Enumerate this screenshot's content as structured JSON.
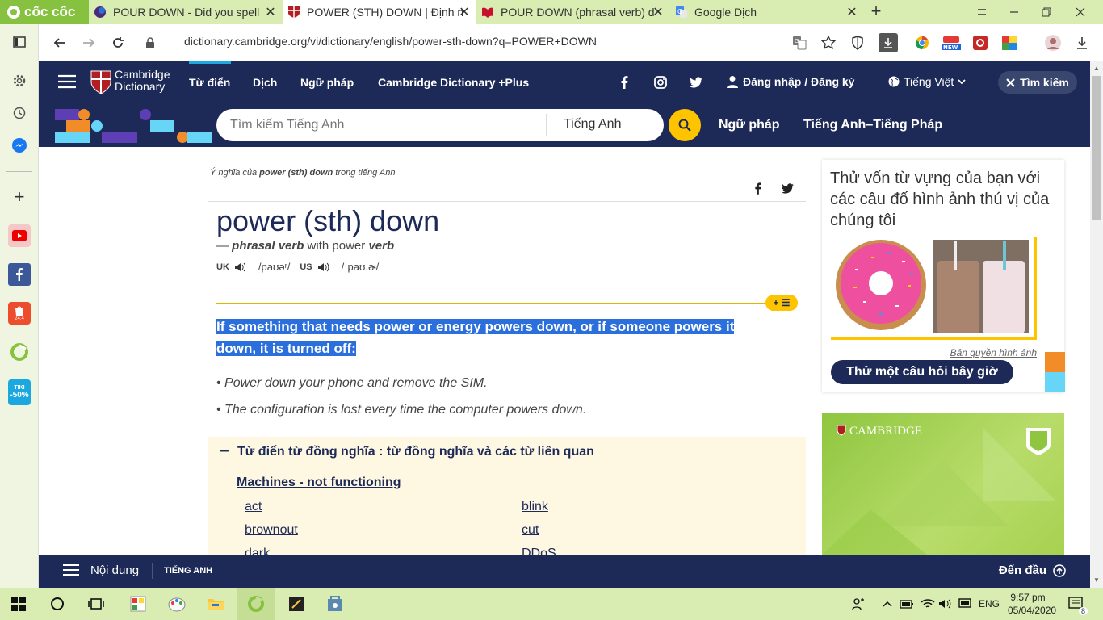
{
  "browser": {
    "brand": "cốc cốc",
    "tabs": [
      {
        "title": "POUR DOWN - Did you spell",
        "active": false
      },
      {
        "title": "POWER (STH) DOWN | Định n",
        "active": true
      },
      {
        "title": "POUR DOWN (phrasal verb) d",
        "active": false
      },
      {
        "title": "Google Dịch",
        "active": false
      }
    ],
    "url": "dictionary.cambridge.org/vi/dictionary/english/power-sth-down?q=POWER+DOWN"
  },
  "sidebar_apps": {
    "tiki_badge": "TIKI",
    "tiki_discount": "-50%",
    "shopee_label": "24.4"
  },
  "header": {
    "logo_line1": "Cambridge",
    "logo_line2": "Dictionary",
    "nav": [
      "Từ điển",
      "Dịch",
      "Ngữ pháp",
      "Cambridge Dictionary +Plus"
    ],
    "login": "Đăng nhập / Đăng ký",
    "language": "Tiếng Việt",
    "search_button": "Tìm kiếm"
  },
  "searchbar": {
    "placeholder": "Tìm kiếm Tiếng Anh",
    "dictionary": "Tiếng Anh",
    "links": [
      "Ngữ pháp",
      "Tiếng Anh–Tiếng Pháp"
    ]
  },
  "entry": {
    "breadcrumb_pre": "Ý nghĩa của ",
    "breadcrumb_word": "power (sth) down",
    "breadcrumb_post": " trong tiếng Anh",
    "headword": "power (sth) down",
    "pos_prefix": "— ",
    "pos": "phrasal verb",
    "pos_with": " with power ",
    "pos_verb": "verb",
    "uk_label": "UK",
    "uk_ipa": "/paʊəʳ/",
    "us_label": "US",
    "us_ipa": "/ˈpaʊ.ɚ/",
    "definition": "If something that needs power or energy powers down, or if someone powers it down, it is turned off:",
    "examples": [
      "Power down your phone and remove the SIM.",
      "The configuration is lost every time the computer powers down."
    ]
  },
  "synonyms": {
    "heading": "Từ điển từ đồng nghĩa : từ đồng nghĩa và các từ liên quan",
    "category": "Machines - not functioning",
    "left": [
      "act",
      "brownout",
      "dark"
    ],
    "right": [
      "blink",
      "cut",
      "DDoS"
    ]
  },
  "quiz": {
    "title": "Thử vốn từ vựng của bạn với các câu đố hình ảnh thú vị của chúng tôi",
    "credit": "Bản quyền hình ảnh",
    "button": "Thử một câu hỏi bây giờ"
  },
  "ad": {
    "brand": "CAMBRIDGE"
  },
  "bottom": {
    "contents": "Nội dung",
    "lang": "TIẾNG ANH",
    "to_top": "Đến đầu"
  },
  "taskbar": {
    "lang": "ENG",
    "time": "9:57 pm",
    "date": "05/04/2020",
    "notifications": "8"
  },
  "colors": {
    "brand_navy": "#1d2a57",
    "accent_yellow": "#fec400",
    "highlight": "#2a6fdb",
    "synonym_bg": "#fef7e2",
    "coccoc_green": "#86c240"
  }
}
